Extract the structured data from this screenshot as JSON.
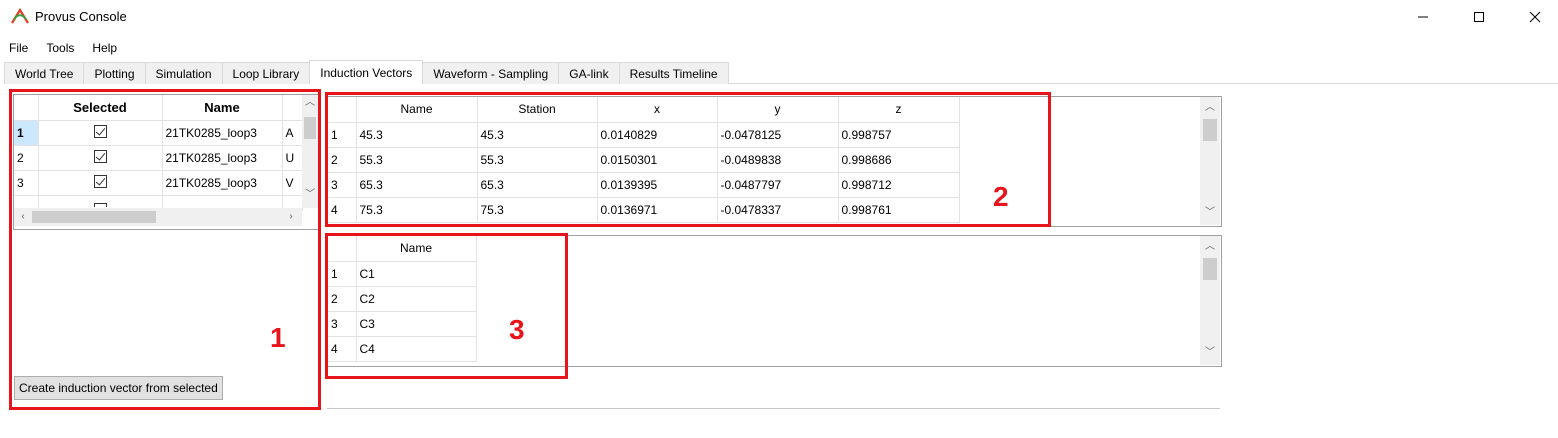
{
  "window": {
    "title": "Provus Console",
    "controls": {
      "minimize": "—",
      "maximize": "☐",
      "close": "✕"
    }
  },
  "menu": [
    "File",
    "Tools",
    "Help"
  ],
  "tabs": [
    {
      "label": "World Tree"
    },
    {
      "label": "Plotting"
    },
    {
      "label": "Simulation"
    },
    {
      "label": "Loop Library"
    },
    {
      "label": "Induction Vectors"
    },
    {
      "label": "Waveform - Sampling"
    },
    {
      "label": "GA-link"
    },
    {
      "label": "Results Timeline"
    }
  ],
  "active_tab": "Induction Vectors",
  "loop_table": {
    "headers": {
      "selected": "Selected",
      "name": "Name"
    },
    "rows": [
      {
        "num": "1",
        "selected": true,
        "name": "21TK0285_loop3",
        "extra": "A"
      },
      {
        "num": "2",
        "selected": true,
        "name": "21TK0285_loop3",
        "extra": "U"
      },
      {
        "num": "3",
        "selected": true,
        "name": "21TK0285_loop3",
        "extra": "V"
      }
    ],
    "sort_indicator": "^"
  },
  "create_button": "Create induction vector from selected",
  "vector_table": {
    "headers": {
      "name": "Name",
      "station": "Station",
      "x": "x",
      "y": "y",
      "z": "z"
    },
    "rows": [
      {
        "num": "1",
        "name": "45.3",
        "station": "45.3",
        "x": "0.0140829",
        "y": "-0.0478125",
        "z": "0.998757"
      },
      {
        "num": "2",
        "name": "55.3",
        "station": "55.3",
        "x": "0.0150301",
        "y": "-0.0489838",
        "z": "0.998686"
      },
      {
        "num": "3",
        "name": "65.3",
        "station": "65.3",
        "x": "0.0139395",
        "y": "-0.0487797",
        "z": "0.998712"
      },
      {
        "num": "4",
        "name": "75.3",
        "station": "75.3",
        "x": "0.0136971",
        "y": "-0.0478337",
        "z": "0.998761"
      }
    ]
  },
  "component_table": {
    "headers": {
      "name": "Name"
    },
    "rows": [
      {
        "num": "1",
        "name": "C1"
      },
      {
        "num": "2",
        "name": "C2"
      },
      {
        "num": "3",
        "name": "C3"
      },
      {
        "num": "4",
        "name": "C4"
      }
    ]
  },
  "annotations": {
    "one": "1",
    "two": "2",
    "three": "3"
  },
  "colors": {
    "annotation_red": "#e8141b",
    "active_row": "#cce8ff"
  }
}
